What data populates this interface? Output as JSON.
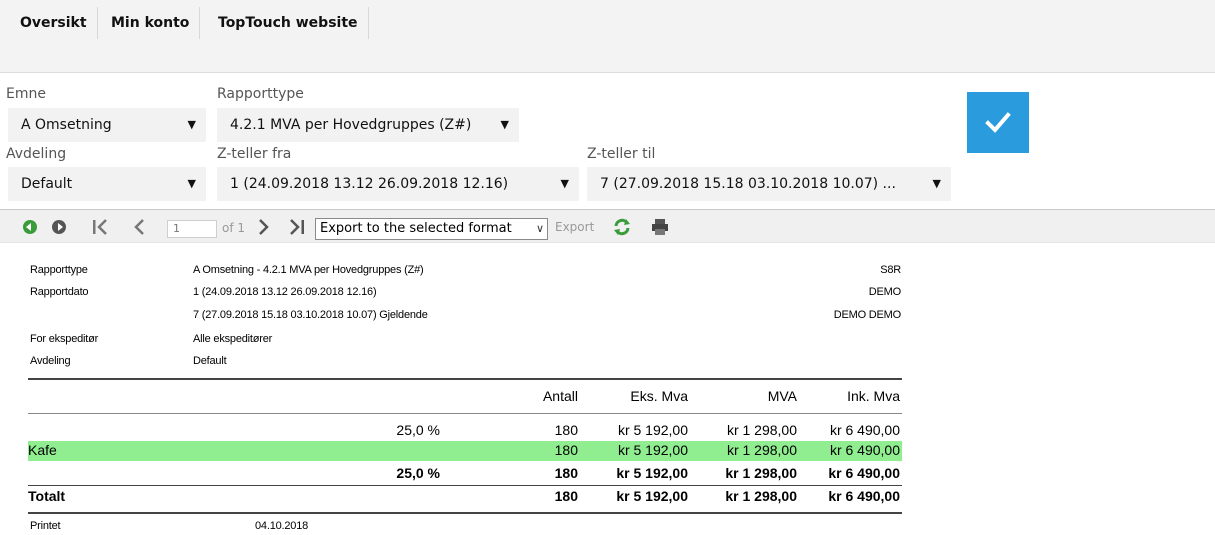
{
  "nav": {
    "tabs": [
      "Oversikt",
      "Min konto",
      "TopTouch website"
    ]
  },
  "filters": {
    "emne_label": "Emne",
    "emne_value": "A Omsetning",
    "rapporttype_label": "Rapporttype",
    "rapporttype_value": "4.2.1 MVA per Hovedgruppes (Z#)",
    "avdeling_label": "Avdeling",
    "avdeling_value": "Default",
    "zfra_label": "Z-teller fra",
    "zfra_value": "1 (24.09.2018 13.12 26.09.2018 12.16)",
    "ztil_label": "Z-teller til",
    "ztil_value": "7 (27.09.2018 15.18 03.10.2018 10.07) ...",
    "dropdown_glyph": "▼"
  },
  "toolbar": {
    "page_value": "1",
    "page_of": "of 1",
    "export_format": "Export to the selected format",
    "export_label": "Export"
  },
  "report": {
    "meta": {
      "rapporttype_key": "Rapporttype",
      "rapporttype_val": "A Omsetning - 4.2.1 MVA per Hovedgruppes (Z#)",
      "rapportdato_key": "Rapportdato",
      "rapportdato_val1": "1 (24.09.2018 13.12 26.09.2018 12.16)",
      "rapportdato_val2": "7 (27.09.2018 15.18 03.10.2018 10.07) Gjeldende",
      "ekspeditor_key": "For ekspeditør",
      "ekspeditor_val": "Alle ekspeditører",
      "avdeling_key": "Avdeling",
      "avdeling_val": "Default",
      "right1": "S8R",
      "right2": "DEMO",
      "right3": "DEMO DEMO"
    },
    "columns": [
      "Antall",
      "Eks. Mva",
      "MVA",
      "Ink. Mva"
    ],
    "rows": [
      {
        "label": "",
        "pct": "25,0 %",
        "antall": "180",
        "eks": "kr 5 192,00",
        "mva": "kr 1 298,00",
        "ink": "kr 6 490,00"
      },
      {
        "label": "Kafe",
        "pct": "",
        "antall": "180",
        "eks": "kr 5 192,00",
        "mva": "kr 1 298,00",
        "ink": "kr 6 490,00"
      },
      {
        "label": "",
        "pct": "25,0 %",
        "antall": "180",
        "eks": "kr 5 192,00",
        "mva": "kr 1 298,00",
        "ink": "kr 6 490,00"
      },
      {
        "label": "Totalt",
        "pct": "",
        "antall": "180",
        "eks": "kr 5 192,00",
        "mva": "kr 1 298,00",
        "ink": "kr 6 490,00"
      }
    ],
    "printet_key": "Printet",
    "printet_val": "04.10.2018"
  },
  "colors": {
    "highlight_row": "#90ee90",
    "accent": "#2a9cde"
  }
}
